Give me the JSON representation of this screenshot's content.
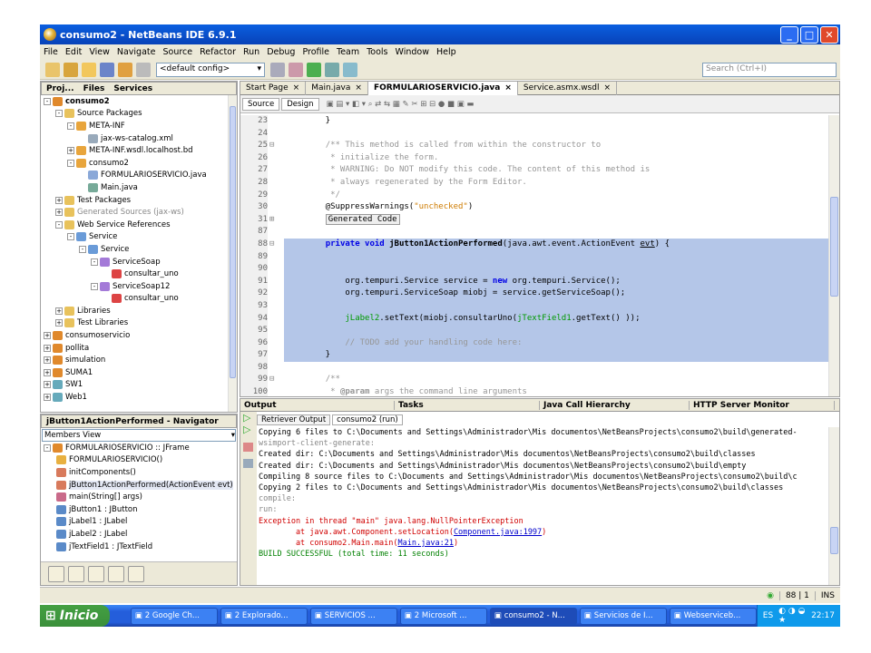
{
  "window": {
    "title": "consumo2 - NetBeans IDE 6.9.1"
  },
  "menu": [
    "File",
    "Edit",
    "View",
    "Navigate",
    "Source",
    "Refactor",
    "Run",
    "Debug",
    "Profile",
    "Team",
    "Tools",
    "Window",
    "Help"
  ],
  "toolbar": {
    "config": "<default config>",
    "search_placeholder": "Search (Ctrl+I)"
  },
  "project_panel": {
    "tabs": [
      "Proj...",
      "Files",
      "Services"
    ],
    "tree": [
      {
        "level": 0,
        "toggle": "-",
        "label": "consumo2",
        "bold": true,
        "icon": "project-icon"
      },
      {
        "level": 1,
        "toggle": "-",
        "label": "Source Packages",
        "icon": "folder-icon"
      },
      {
        "level": 2,
        "toggle": "-",
        "label": "META-INF",
        "icon": "package-icon"
      },
      {
        "level": 3,
        "toggle": "",
        "label": "jax-ws-catalog.xml",
        "icon": "xml-file-icon"
      },
      {
        "level": 2,
        "toggle": "+",
        "label": "META-INF.wsdl.localhost.bd",
        "icon": "package-icon"
      },
      {
        "level": 2,
        "toggle": "-",
        "label": "consumo2",
        "icon": "package-icon"
      },
      {
        "level": 3,
        "toggle": "",
        "label": "FORMULARIOSERVICIO.java",
        "icon": "form-file-icon"
      },
      {
        "level": 3,
        "toggle": "",
        "label": "Main.java",
        "icon": "java-file-icon"
      },
      {
        "level": 1,
        "toggle": "+",
        "label": "Test Packages",
        "icon": "folder-icon"
      },
      {
        "level": 1,
        "toggle": "+",
        "label": "Generated Sources (jax-ws)",
        "icon": "folder-icon",
        "gray": true
      },
      {
        "level": 1,
        "toggle": "-",
        "label": "Web Service References",
        "icon": "folder-icon"
      },
      {
        "level": 2,
        "toggle": "-",
        "label": "Service",
        "icon": "service-icon"
      },
      {
        "level": 3,
        "toggle": "-",
        "label": "Service",
        "icon": "service-icon"
      },
      {
        "level": 4,
        "toggle": "-",
        "label": "ServiceSoap",
        "icon": "port-icon"
      },
      {
        "level": 5,
        "toggle": "",
        "label": "consultar_uno",
        "icon": "operation-icon"
      },
      {
        "level": 4,
        "toggle": "-",
        "label": "ServiceSoap12",
        "icon": "port-icon"
      },
      {
        "level": 5,
        "toggle": "",
        "label": "consultar_uno",
        "icon": "operation-icon"
      },
      {
        "level": 1,
        "toggle": "+",
        "label": "Libraries",
        "icon": "folder-icon"
      },
      {
        "level": 1,
        "toggle": "+",
        "label": "Test Libraries",
        "icon": "folder-icon"
      },
      {
        "level": 0,
        "toggle": "+",
        "label": "consumoservicio",
        "icon": "project-icon"
      },
      {
        "level": 0,
        "toggle": "+",
        "label": "pollita",
        "icon": "project-icon"
      },
      {
        "level": 0,
        "toggle": "+",
        "label": "simulation",
        "icon": "project-icon"
      },
      {
        "level": 0,
        "toggle": "+",
        "label": "SUMA1",
        "icon": "project-icon"
      },
      {
        "level": 0,
        "toggle": "+",
        "label": "SW1",
        "icon": "web-project-icon"
      },
      {
        "level": 0,
        "toggle": "+",
        "label": "Web1",
        "icon": "web-project-icon"
      }
    ]
  },
  "navigator": {
    "title": "jButton1ActionPerformed - Navigator",
    "filter": "Members View",
    "items": [
      {
        "level": 0,
        "toggle": "-",
        "label": "FORMULARIOSERVICIO :: JFrame",
        "icon": "class-icon"
      },
      {
        "level": 1,
        "label": "FORMULARIOSERVICIO()",
        "icon": "constructor-icon"
      },
      {
        "level": 1,
        "label": "initComponents()",
        "icon": "method-icon"
      },
      {
        "level": 1,
        "label": "jButton1ActionPerformed(ActionEvent evt)",
        "icon": "method-icon",
        "selected": true
      },
      {
        "level": 1,
        "label": "main(String[] args)",
        "icon": "static-method-icon"
      },
      {
        "level": 1,
        "label": "jButton1 : JButton",
        "icon": "field-icon"
      },
      {
        "level": 1,
        "label": "jLabel1 : JLabel",
        "icon": "field-icon"
      },
      {
        "level": 1,
        "label": "jLabel2 : JLabel",
        "icon": "field-icon"
      },
      {
        "level": 1,
        "label": "jTextField1 : JTextField",
        "icon": "field-icon"
      }
    ]
  },
  "editor": {
    "tabs": [
      {
        "label": "Start Page",
        "active": false
      },
      {
        "label": "Main.java",
        "active": false
      },
      {
        "label": "FORMULARIOSERVICIO.java",
        "active": true
      },
      {
        "label": "Service.asmx.wsdl",
        "active": false
      }
    ],
    "modes": [
      "Source",
      "Design"
    ],
    "lines": [
      {
        "n": "23",
        "fold": "",
        "sel": false,
        "html": "    }"
      },
      {
        "n": "24",
        "fold": "",
        "sel": false,
        "html": ""
      },
      {
        "n": "25",
        "fold": "-",
        "sel": false,
        "html": "    <span class=\"cm\">/** This method is called from within the constructor to</span>"
      },
      {
        "n": "26",
        "fold": "",
        "sel": false,
        "html": "<span class=\"cm\">     * initialize the form.</span>"
      },
      {
        "n": "27",
        "fold": "",
        "sel": false,
        "html": "<span class=\"cm\">     * WARNING: Do NOT modify this code. The content of this method is</span>"
      },
      {
        "n": "28",
        "fold": "",
        "sel": false,
        "html": "<span class=\"cm\">     * always regenerated by the Form Editor.</span>"
      },
      {
        "n": "29",
        "fold": "",
        "sel": false,
        "html": "<span class=\"cm\">     */</span>"
      },
      {
        "n": "30",
        "fold": "",
        "sel": false,
        "html": "    @SuppressWarnings(<span class=\"str\">\"unchecked\"</span>)"
      },
      {
        "n": "31",
        "fold": "+",
        "sel": false,
        "html": "    <span style=\"border:1px solid #999;background:#eee;padding:0 2px\">Generated Code</span>"
      },
      {
        "n": "87",
        "fold": "",
        "sel": false,
        "html": ""
      },
      {
        "n": "88",
        "fold": "-",
        "sel": true,
        "html": "    <span class=\"kw\">private void</span> <span class=\"jfn\">jButton1ActionPerformed</span>(java.awt.event.ActionEvent <u>evt</u>) {"
      },
      {
        "n": "89",
        "fold": "",
        "sel": true,
        "html": ""
      },
      {
        "n": "90",
        "fold": "",
        "sel": true,
        "html": ""
      },
      {
        "n": "91",
        "fold": "",
        "sel": true,
        "html": "        org.tempuri.Service service = <span class=\"kw\">new</span> org.tempuri.Service();"
      },
      {
        "n": "92",
        "fold": "",
        "sel": true,
        "html": "        org.tempuri.ServiceSoap miobj = service.getServiceSoap();"
      },
      {
        "n": "93",
        "fold": "",
        "sel": true,
        "html": ""
      },
      {
        "n": "94",
        "fold": "",
        "sel": true,
        "html": "        <span class=\"fld\">jLabel2</span>.setText(miobj.consultarUno(<span class=\"fld\">jTextField1</span>.getText() ));"
      },
      {
        "n": "95",
        "fold": "",
        "sel": true,
        "html": ""
      },
      {
        "n": "96",
        "fold": "",
        "sel": true,
        "html": "        <span class=\"cm\">// TODO add your handling code here:</span>"
      },
      {
        "n": "97",
        "fold": "",
        "sel": true,
        "html": "    }"
      },
      {
        "n": "98",
        "fold": "",
        "sel": false,
        "html": ""
      },
      {
        "n": "99",
        "fold": "-",
        "sel": false,
        "html": "    <span class=\"cm\">/**</span>"
      },
      {
        "n": "100",
        "fold": "",
        "sel": false,
        "html": "<span class=\"cm\">     * <b>@param</b> args the command line arguments</span>"
      }
    ]
  },
  "output": {
    "panel_tabs": [
      "Output",
      "Tasks",
      "Java Call Hierarchy",
      "HTTP Server Monitor"
    ],
    "sub_tabs": [
      "Retriever Output",
      "consumo2 (run)"
    ],
    "lines": [
      {
        "cls": "",
        "text": "Copying 6 files to C:\\Documents and Settings\\Administrador\\Mis documentos\\NetBeansProjects\\consumo2\\build\\generated-"
      },
      {
        "cls": "gray",
        "text": "wsimport-client-generate:"
      },
      {
        "cls": "",
        "text": "Created dir: C:\\Documents and Settings\\Administrador\\Mis documentos\\NetBeansProjects\\consumo2\\build\\classes"
      },
      {
        "cls": "",
        "text": "Created dir: C:\\Documents and Settings\\Administrador\\Mis documentos\\NetBeansProjects\\consumo2\\build\\empty"
      },
      {
        "cls": "",
        "text": "Compiling 8 source files to C:\\Documents and Settings\\Administrador\\Mis documentos\\NetBeansProjects\\consumo2\\build\\c"
      },
      {
        "cls": "",
        "text": "Copying 2 files to C:\\Documents and Settings\\Administrador\\Mis documentos\\NetBeansProjects\\consumo2\\build\\classes"
      },
      {
        "cls": "gray",
        "text": "compile:"
      },
      {
        "cls": "gray",
        "text": "run:"
      },
      {
        "cls": "red",
        "text": "Exception in thread \"main\" java.lang.NullPointerException"
      },
      {
        "cls": "red",
        "text": "        at java.awt.Component.setLocation(",
        "link": "Component.java:1997",
        "tail": ")"
      },
      {
        "cls": "red",
        "text": "        at consumo2.Main.main(",
        "link": "Main.java:21",
        "tail": ")"
      },
      {
        "cls": "green",
        "text": "BUILD SUCCESSFUL (total time: 11 seconds)"
      }
    ]
  },
  "status": {
    "position": "88 | 1",
    "mode": "INS"
  },
  "taskbar": {
    "start": "Inicio",
    "tasks": [
      {
        "label": "2 Google Ch...",
        "active": false
      },
      {
        "label": "2 Explorado...",
        "active": false
      },
      {
        "label": "SERVICIOS ...",
        "active": false
      },
      {
        "label": "2 Microsoft ...",
        "active": false
      },
      {
        "label": "consumo2 - N...",
        "active": true
      },
      {
        "label": "Servicios de I...",
        "active": false
      },
      {
        "label": "Webserviceb...",
        "active": false
      }
    ],
    "lang": "ES",
    "clock": "22:17"
  }
}
